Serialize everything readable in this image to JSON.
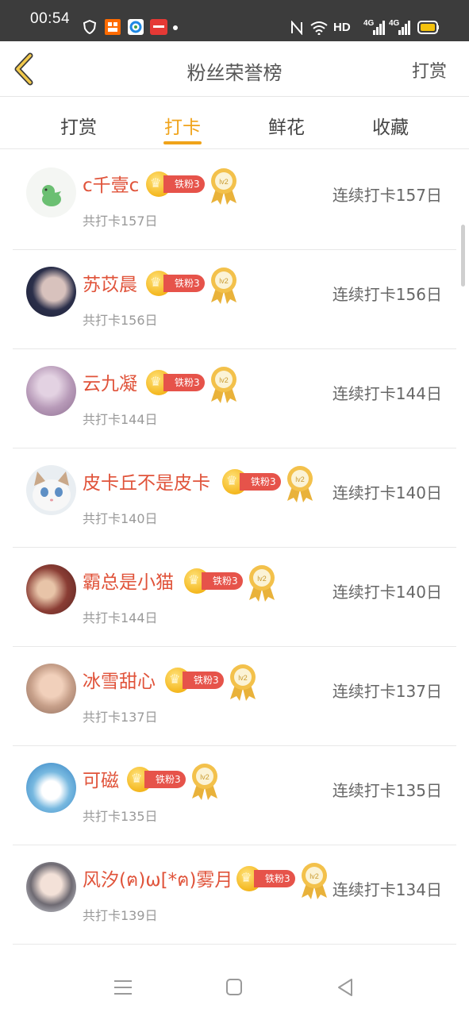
{
  "status_bar": {
    "time": "00:54",
    "right_text": "HD",
    "network_1": "4G",
    "network_2": "4G"
  },
  "header": {
    "back_icon": "chevron-left-icon",
    "title": "粉丝荣誉榜",
    "action_label": "打赏"
  },
  "tabs": [
    {
      "label": "打赏",
      "active": false
    },
    {
      "label": "打卡",
      "active": true
    },
    {
      "label": "鲜花",
      "active": false
    },
    {
      "label": "收藏",
      "active": false
    }
  ],
  "badge_text": "铁粉3",
  "medal_text": "lv2",
  "colors": {
    "accent": "#f0a31a",
    "name": "#e0533a",
    "badge": "#e6534a"
  },
  "rows": [
    {
      "name": "c千壹c",
      "total": "共打卡157日",
      "streak": "连续打卡157日"
    },
    {
      "name": "苏苡晨",
      "total": "共打卡156日",
      "streak": "连续打卡156日"
    },
    {
      "name": "云九凝",
      "total": "共打卡144日",
      "streak": "连续打卡144日"
    },
    {
      "name": "皮卡丘不是皮卡",
      "total": "共打卡140日",
      "streak": "连续打卡140日"
    },
    {
      "name": "霸总是小猫",
      "total": "共打卡144日",
      "streak": "连续打卡140日"
    },
    {
      "name": "冰雪甜心",
      "total": "共打卡137日",
      "streak": "连续打卡137日"
    },
    {
      "name": "可磁",
      "total": "共打卡135日",
      "streak": "连续打卡135日"
    },
    {
      "name": "风汐(ฅ)ω[*ฅ)雾月",
      "total": "共打卡139日",
      "streak": "连续打卡134日"
    }
  ],
  "nav": {
    "menu_icon": "menu-icon",
    "home_icon": "home-square-icon",
    "back_icon": "back-triangle-icon"
  }
}
